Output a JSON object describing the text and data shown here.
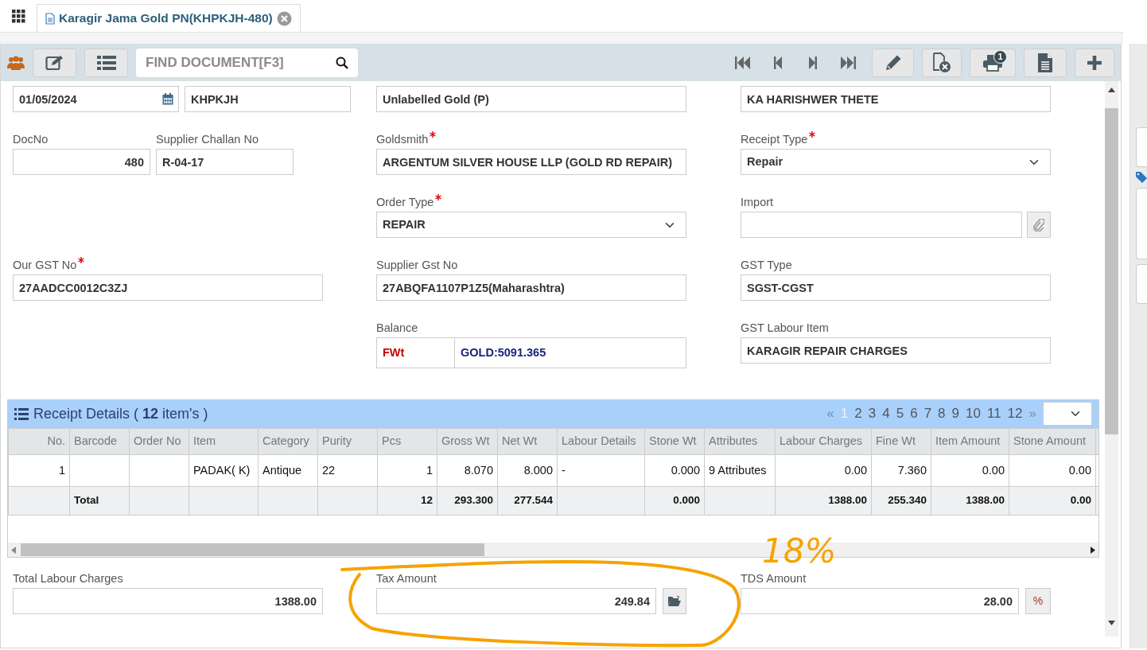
{
  "tab": {
    "title": "Karagir Jama Gold PN(KHPKJH-480)",
    "selected": true
  },
  "toolbar": {
    "search_placeholder": "FIND DOCUMENT[F3]",
    "print_count": "1"
  },
  "form_rows": [
    {
      "left": [
        {
          "kind": "date",
          "value": "01/05/2024"
        },
        {
          "kind": "text",
          "value": "KHPKJH"
        }
      ],
      "middle": [
        {
          "kind": "text",
          "value": "Unlabelled Gold (P)"
        }
      ],
      "right": [
        {
          "kind": "text",
          "value": "KA HARISHWER THETE"
        }
      ]
    },
    {
      "left": [
        {
          "label": "DocNo",
          "kind": "number",
          "value": "480"
        },
        {
          "label": "Supplier Challan No",
          "kind": "text",
          "value": "R-04-17"
        }
      ],
      "middle": [
        {
          "label": "Goldsmith",
          "required": true,
          "kind": "text",
          "value": "ARGENTUM SILVER HOUSE LLP (GOLD RD REPAIR)"
        }
      ],
      "right": [
        {
          "label": "Receipt Type",
          "required": true,
          "kind": "select",
          "value": "Repair"
        }
      ]
    },
    {
      "middle": [
        {
          "label": "Order Type",
          "required": true,
          "kind": "select",
          "value": "REPAIR"
        }
      ],
      "right": [
        {
          "label": "Import",
          "kind": "attach"
        }
      ]
    },
    {
      "left": [
        {
          "label": "Our GST No",
          "required": true,
          "kind": "text",
          "value": "27AADCC0012C3ZJ"
        }
      ],
      "middle": [
        {
          "label": "Supplier Gst No",
          "kind": "text",
          "value": "27ABQFA1107P1Z5(Maharashtra)"
        }
      ],
      "right": [
        {
          "label": "GST Type",
          "kind": "text",
          "value": "SGST-CGST"
        }
      ]
    },
    {
      "middle": [
        {
          "label": "Balance",
          "kind": "balance",
          "unit": "FWt",
          "value": "GOLD:5091.365"
        }
      ],
      "right": [
        {
          "label": "GST Labour Item",
          "kind": "text",
          "value": "KARAGIR REPAIR CHARGES"
        }
      ]
    }
  ],
  "receipt_details": {
    "title": "Receipt Details ( **12** item's )",
    "pagination": {
      "prev": "«",
      "next": "»",
      "pages": [
        {
          "label": "1",
          "selected": true
        },
        {
          "label": "2",
          "selected": false
        },
        {
          "label": "3",
          "selected": false
        },
        {
          "label": "4",
          "selected": false
        },
        {
          "label": "5",
          "selected": false
        },
        {
          "label": "6",
          "selected": false
        },
        {
          "label": "7",
          "selected": false
        },
        {
          "label": "8",
          "selected": false
        },
        {
          "label": "9",
          "selected": false
        },
        {
          "label": "10",
          "selected": false
        },
        {
          "label": "11",
          "selected": false
        },
        {
          "label": "12",
          "selected": false
        }
      ]
    },
    "columns": [
      {
        "label": "No.",
        "kind": "number"
      },
      {
        "label": "Barcode",
        "kind": "text"
      },
      {
        "label": "Order No",
        "kind": "text"
      },
      {
        "label": "Item",
        "kind": "text"
      },
      {
        "label": "Category",
        "kind": "text"
      },
      {
        "label": "Purity",
        "kind": "text"
      },
      {
        "label": "Pcs",
        "kind": "number"
      },
      {
        "label": "Gross Wt",
        "kind": "number"
      },
      {
        "label": "Net Wt",
        "kind": "number"
      },
      {
        "label": "Labour Details",
        "kind": "text"
      },
      {
        "label": "Stone Wt",
        "kind": "number"
      },
      {
        "label": "Attributes",
        "kind": "text"
      },
      {
        "label": "Labour Charges",
        "kind": "number"
      },
      {
        "label": "Fine Wt",
        "kind": "number"
      },
      {
        "label": "Item Amount",
        "kind": "number"
      },
      {
        "label": "Stone Amount",
        "kind": "number"
      }
    ],
    "rows": [
      {
        "no": "1",
        "item": "PADAK( K)",
        "category": "Antique",
        "purity": "22",
        "pcs": "1",
        "gross_wt": "8.070",
        "net_wt": "8.000",
        "labour_details": "-",
        "stone_wt": "0.000",
        "attributes": "9 Attributes",
        "labour_charges": "0.00",
        "fine_wt": "7.360",
        "item_amount": "0.00",
        "stone_amount": "0.00"
      }
    ],
    "total": {
      "barcode": "Total",
      "pcs": "12",
      "gross_wt": "293.300",
      "net_wt": "277.544",
      "stone_wt": "0.000",
      "labour_charges": "1388.00",
      "fine_wt": "255.340",
      "item_amount": "1388.00",
      "stone_amount": "0.00"
    }
  },
  "totals": [
    {
      "label": "Total Labour Charges",
      "value": "1388.00"
    },
    {
      "label": "Tax Amount",
      "value": "249.84",
      "action": {
        "kind": "icon"
      }
    },
    {
      "label": "TDS Amount",
      "value": "28.00",
      "action": {
        "kind": "text",
        "text": "%"
      }
    }
  ],
  "annotation": {
    "text": "18%"
  }
}
